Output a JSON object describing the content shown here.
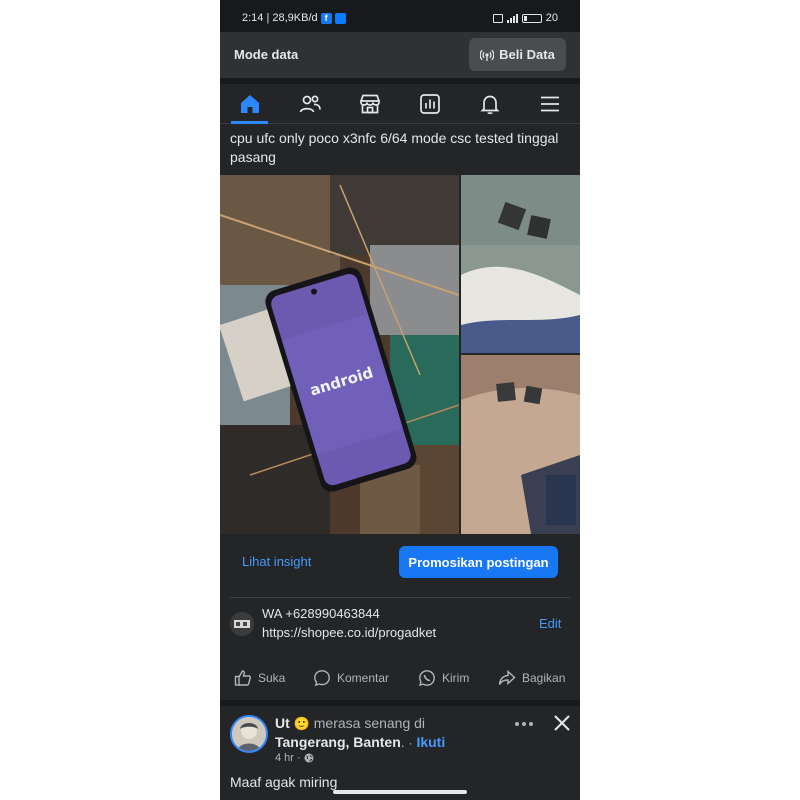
{
  "status_bar": {
    "time_speed": "2:14 | 28,9KB/d",
    "fb_glyph": "f",
    "battery_level": "20",
    "battery_fraction": 0.2
  },
  "data_bar": {
    "label": "Mode data",
    "buy_button": "Beli Data"
  },
  "nav": {
    "items": [
      {
        "id": "home",
        "icon": "home-icon",
        "active": true
      },
      {
        "id": "friends",
        "icon": "friends-icon",
        "active": false
      },
      {
        "id": "marketplace",
        "icon": "marketplace-icon",
        "active": false
      },
      {
        "id": "dashboard",
        "icon": "dashboard-icon",
        "active": false
      },
      {
        "id": "notifications",
        "icon": "bell-icon",
        "active": false
      },
      {
        "id": "menu",
        "icon": "menu-icon",
        "active": false
      }
    ],
    "accent": "#2d88ff"
  },
  "post": {
    "text": "cpu ufc only  poco x3nfc 6/64 mode csc tested tinggal pasang",
    "phone_screen_text": "android",
    "insight_label": "Lihat insight",
    "promote_label": "Promosikan postingan",
    "comment_line1": "WA +628990463844",
    "comment_line2": "https://shopee.co.id/progadket",
    "edit_label": "Edit",
    "actions": {
      "like": "Suka",
      "comment": "Komentar",
      "send": "Kirim",
      "share": "Bagikan"
    }
  },
  "next_post": {
    "author": "Ut",
    "emoji": "🙂",
    "feeling": "merasa senang di",
    "location": "Tangerang, Banten",
    "follow_label": "Ikuti",
    "time": "4 hr",
    "text": "Maaf agak miring"
  },
  "colors": {
    "background": "#242526",
    "link": "#4599ff",
    "primary_button": "#1877f2"
  }
}
